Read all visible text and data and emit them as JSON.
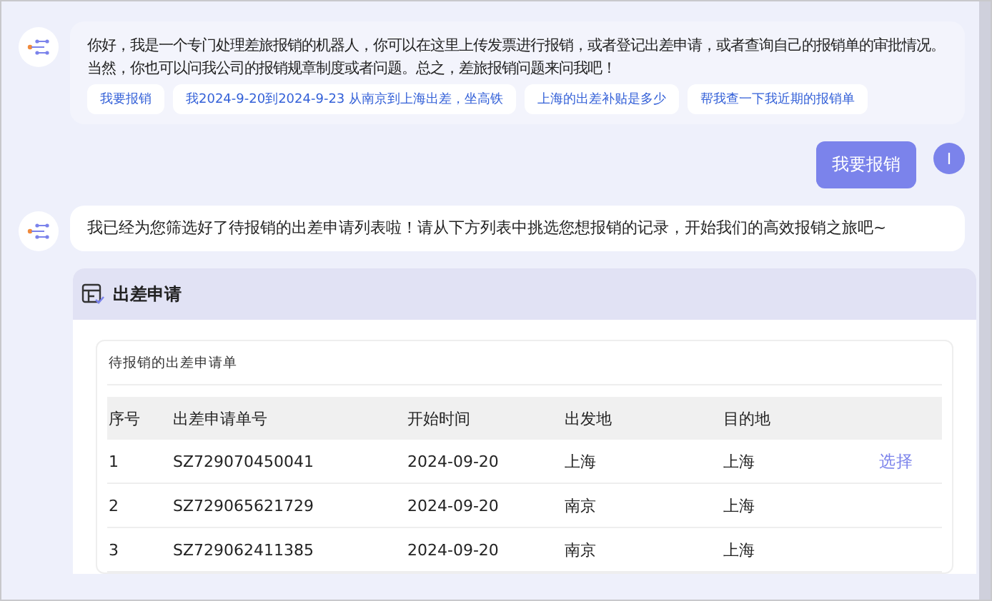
{
  "messages": [
    {
      "kind": "bot",
      "text": "你好，我是一个专门处理差旅报销的机器人，你可以在这里上传发票进行报销，或者登记出差申请，或者查询自己的报销单的审批情况。当然，你也可以问我公司的报销规章制度或者问题。总之，差旅报销问题来问我吧！",
      "suggestions": [
        "我要报销",
        "我2024-9-20到2024-9-23 从南京到上海出差，坐高铁",
        "上海的出差补贴是多少",
        "帮我查一下我近期的报销单"
      ]
    },
    {
      "kind": "user",
      "text": "我要报销",
      "avatar": "I"
    },
    {
      "kind": "bot",
      "text": "我已经为您筛选好了待报销的出差申请列表啦！请从下方列表中挑选您想报销的记录，开始我们的高效报销之旅吧~"
    }
  ],
  "card": {
    "title": "出差申请",
    "subtitle": "待报销的出差申请单",
    "columns": [
      "序号",
      "出差申请单号",
      "开始时间",
      "出发地",
      "目的地"
    ],
    "rows": [
      {
        "cells": [
          "1",
          "SZ729070450041",
          "2024-09-20",
          "上海",
          "上海"
        ],
        "action": "选择"
      },
      {
        "cells": [
          "2",
          "SZ729065621729",
          "2024-09-20",
          "南京",
          "上海"
        ]
      },
      {
        "cells": [
          "3",
          "SZ729062411385",
          "2024-09-20",
          "南京",
          "上海"
        ]
      }
    ]
  }
}
